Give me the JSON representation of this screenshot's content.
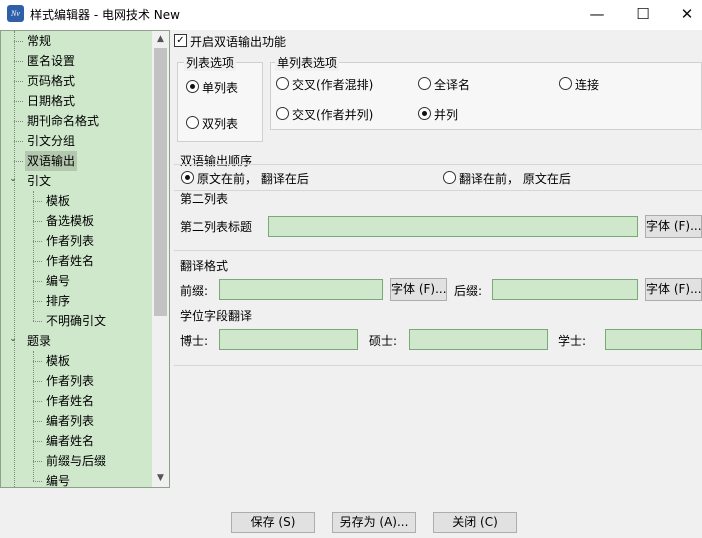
{
  "window": {
    "title": "样式编辑器 - 电网技术 New",
    "icon_text": "Nv",
    "minimize_glyph": "—",
    "maximize_glyph": "☐",
    "close_glyph": "✕"
  },
  "tree": {
    "items": [
      {
        "label": "常规",
        "level": 1
      },
      {
        "label": "匿名设置",
        "level": 1
      },
      {
        "label": "页码格式",
        "level": 1
      },
      {
        "label": "日期格式",
        "level": 1
      },
      {
        "label": "期刊命名格式",
        "level": 1
      },
      {
        "label": "引文分组",
        "level": 1
      },
      {
        "label": "双语输出",
        "level": 1,
        "selected": true
      },
      {
        "label": "引文",
        "level": 1,
        "expanded": true
      },
      {
        "label": "模板",
        "level": 2
      },
      {
        "label": "备选模板",
        "level": 2
      },
      {
        "label": "作者列表",
        "level": 2
      },
      {
        "label": "作者姓名",
        "level": 2
      },
      {
        "label": "编号",
        "level": 2
      },
      {
        "label": "排序",
        "level": 2
      },
      {
        "label": "不明确引文",
        "level": 2
      },
      {
        "label": "题录",
        "level": 1,
        "expanded": true
      },
      {
        "label": "模板",
        "level": 2
      },
      {
        "label": "作者列表",
        "level": 2
      },
      {
        "label": "作者姓名",
        "level": 2
      },
      {
        "label": "编者列表",
        "level": 2
      },
      {
        "label": "编者姓名",
        "level": 2
      },
      {
        "label": "前缀与后缀",
        "level": 2
      },
      {
        "label": "编号",
        "level": 2
      }
    ],
    "expand_glyph": "⌄",
    "scroll_up": "▲",
    "scroll_down": "▼"
  },
  "bilingual": {
    "enable_label": "开启双语输出功能",
    "enable_checked": true,
    "check_glyph": "✓",
    "list_options": {
      "title": "列表选项",
      "single": "单列表",
      "double": "双列表",
      "selected": "single"
    },
    "single_list_options": {
      "title": "单列表选项",
      "cross_mixed": "交叉(作者混排)",
      "full_translation": "全译名",
      "connect": "连接",
      "cross_parallel": "交叉(作者并列)",
      "parallel": "并列",
      "selected": "parallel"
    },
    "order": {
      "title": "双语输出顺序",
      "original_first": "原文在前， 翻译在后",
      "translation_first": "翻译在前， 原文在后",
      "selected": "original_first"
    },
    "second_list": {
      "title": "第二列表",
      "heading_label": "第二列表标题",
      "heading_value": "",
      "font_button": "字体 (F)..."
    },
    "translation_format": {
      "title": "翻译格式",
      "prefix_label": "前缀:",
      "prefix_value": "",
      "prefix_font_button": "字体 (F)...",
      "suffix_label": "后缀:",
      "suffix_value": "",
      "suffix_font_button": "字体 (F)..."
    },
    "degree_translation": {
      "title": "学位字段翻译",
      "doctor_label": "博士:",
      "doctor_value": "",
      "master_label": "硕士:",
      "master_value": "",
      "bachelor_label": "学士:",
      "bachelor_value": ""
    }
  },
  "footer": {
    "save": "保存 (S)",
    "save_as": "另存为 (A)...",
    "close": "关闭 (C)"
  },
  "colors": {
    "tree_bg": "#cfe8cc",
    "field_bg": "#cfe8cc",
    "selected_bg": "#b4c8b0"
  }
}
